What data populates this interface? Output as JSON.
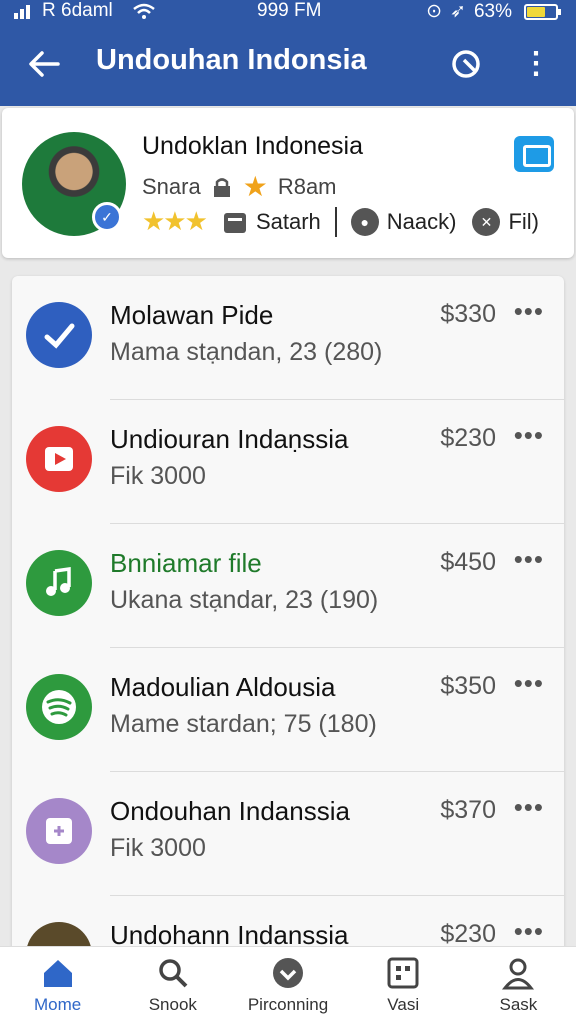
{
  "status": {
    "carrier": "R 6daml",
    "time": "999 FM",
    "battery": "63%",
    "battery_level": 0.63
  },
  "header": {
    "title": "Undouhan Indonsia"
  },
  "profile": {
    "name": "Undoklan Indonesia",
    "subtitle": "Snara",
    "badge_text": "R8am",
    "rating_stars": 3,
    "actions": [
      "Satarh",
      "Naack)",
      "Fil)"
    ]
  },
  "items": [
    {
      "name": "Molawan Pide",
      "desc": "Mama stạndan, 23  (280)",
      "price": "$330",
      "icon": "check-icon",
      "color": "#2f5fbf"
    },
    {
      "name": "Undiouran Indaṇssia",
      "desc": "Fik 3000",
      "price": "$230",
      "icon": "play-icon",
      "color": "#e53935"
    },
    {
      "name": "Bnniamar file",
      "desc": "Ukana stạndar, 23  (190)",
      "price": "$450",
      "icon": "music-icon",
      "color": "#2e9a3e",
      "name_color": "#1f7a2a"
    },
    {
      "name": "Madoulian Aldousia",
      "desc": "Mame stardan; 75  (180)",
      "price": "$350",
      "icon": "spotify-icon",
      "color": "#2e9a3e"
    },
    {
      "name": "Ondouhan Indanssia",
      "desc": "Fik 3000",
      "price": "$370",
      "icon": "app-icon",
      "color": "#a587c9"
    },
    {
      "name": "Undohann Indanssia",
      "desc": "",
      "price": "$230",
      "icon": "photo-icon",
      "color": "#5a4a2a"
    }
  ],
  "tabs": [
    {
      "label": "Mome",
      "icon": "home-icon",
      "active": true
    },
    {
      "label": "Snook",
      "icon": "search-icon",
      "active": false
    },
    {
      "label": "Pirconning",
      "icon": "download-icon",
      "active": false
    },
    {
      "label": "Vasi",
      "icon": "grid-icon",
      "active": false
    },
    {
      "label": "Sask",
      "icon": "user-icon",
      "active": false
    }
  ],
  "more_label": "•••"
}
